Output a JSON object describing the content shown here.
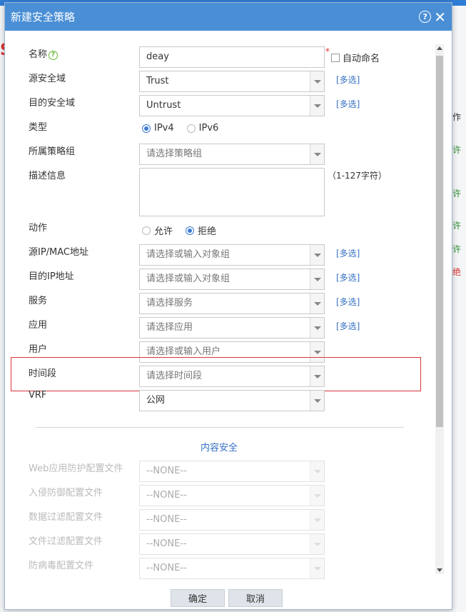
{
  "background": {
    "row_labels": [
      "作",
      "许",
      "许",
      "许",
      "许",
      "绝"
    ]
  },
  "dialog": {
    "title": "新建安全策略",
    "help_symbol": "?",
    "close_symbol": "✕"
  },
  "form": {
    "name": {
      "label": "名称",
      "value": "deay",
      "required_mark": "*",
      "auto_name_label": "自动命名",
      "help_symbol": "?"
    },
    "src_zone": {
      "label": "源安全域",
      "value": "Trust",
      "multi_label": "[多选]"
    },
    "dst_zone": {
      "label": "目的安全域",
      "value": "Untrust",
      "multi_label": "[多选]"
    },
    "type": {
      "label": "类型",
      "options": [
        "IPv4",
        "IPv6"
      ],
      "selected": "IPv4"
    },
    "policy_group": {
      "label": "所属策略组",
      "placeholder": "请选择策略组"
    },
    "description": {
      "label": "描述信息",
      "hint": "（1-127字符）"
    },
    "action": {
      "label": "动作",
      "options": [
        "允许",
        "拒绝"
      ],
      "selected": "拒绝"
    },
    "src_ip": {
      "label": "源IP/MAC地址",
      "placeholder": "请选择或输入对象组",
      "multi_label": "[多选]"
    },
    "dst_ip": {
      "label": "目的IP地址",
      "placeholder": "请选择或输入对象组",
      "multi_label": "[多选]"
    },
    "service": {
      "label": "服务",
      "placeholder": "请选择服务",
      "multi_label": "[多选]"
    },
    "application": {
      "label": "应用",
      "placeholder": "请选择应用",
      "multi_label": "[多选]"
    },
    "user": {
      "label": "用户",
      "placeholder": "请选择或输入用户"
    },
    "time_range": {
      "label": "时间段",
      "placeholder": "请选择时间段"
    },
    "vrf": {
      "label": "VRF",
      "value": "公网"
    }
  },
  "content_security": {
    "title": "内容安全",
    "items": [
      {
        "label": "Web应用防护配置文件",
        "value": "--NONE--"
      },
      {
        "label": "入侵防御配置文件",
        "value": "--NONE--"
      },
      {
        "label": "数据过滤配置文件",
        "value": "--NONE--"
      },
      {
        "label": "文件过滤配置文件",
        "value": "--NONE--"
      },
      {
        "label": "防病毒配置文件",
        "value": "--NONE--"
      }
    ]
  },
  "footer": {
    "ok_label": "确定",
    "cancel_label": "取消"
  },
  "colors": {
    "titlebar": "#4a8fd6",
    "link": "#3470c4",
    "highlight_border": "#d9363e",
    "radio_checked": "#3a7bd5"
  }
}
